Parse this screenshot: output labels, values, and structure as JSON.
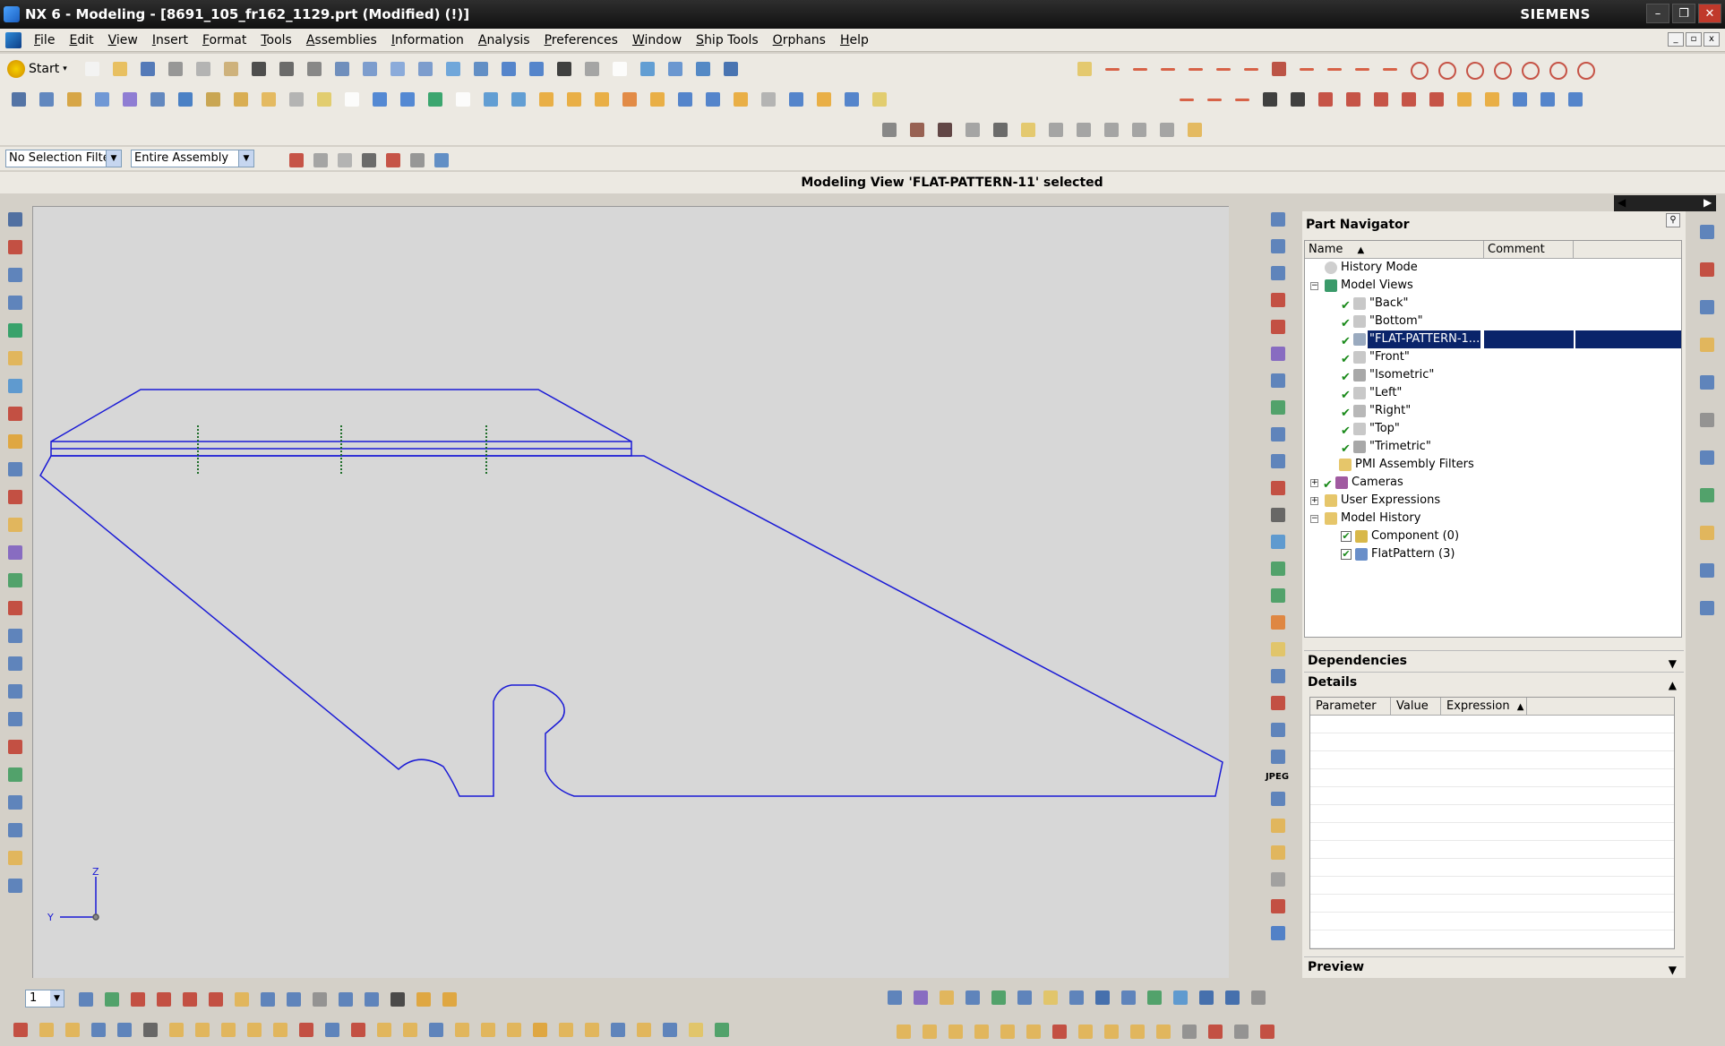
{
  "window": {
    "title": "NX 6 - Modeling - [8691_105_fr162_1129.prt (Modified)   (!)]",
    "brand": "SIEMENS",
    "minimize": "–",
    "restore": "❐",
    "close": "✕"
  },
  "menu": [
    "File",
    "Edit",
    "View",
    "Insert",
    "Format",
    "Tools",
    "Assemblies",
    "Information",
    "Analysis",
    "Preferences",
    "Window",
    "Ship Tools",
    "Orphans",
    "Help"
  ],
  "toolbar": {
    "start_label": "Start"
  },
  "selection": {
    "filter": "No Selection Filter",
    "scope": "Entire Assembly"
  },
  "status": "Modeling View 'FLAT-PATTERN-11' selected",
  "axes": {
    "z": "Z",
    "y": "Y"
  },
  "resource_bar": {
    "jpeg_label": "JPEG"
  },
  "part_navigator": {
    "title": "Part Navigator",
    "columns": {
      "name": "Name",
      "comment": "Comment"
    },
    "nodes": {
      "history_mode": "History Mode",
      "model_views": "Model Views",
      "back": "\"Back\"",
      "bottom": "\"Bottom\"",
      "flat_pattern": "\"FLAT-PATTERN-1...",
      "front": "\"Front\"",
      "isometric": "\"Isometric\"",
      "left": "\"Left\"",
      "right": "\"Right\"",
      "top": "\"Top\"",
      "trimetric": "\"Trimetric\"",
      "pmi": "PMI Assembly Filters",
      "cameras": "Cameras",
      "user_expressions": "User Expressions",
      "model_history": "Model History",
      "component": "Component (0)",
      "flatpattern": "FlatPattern (3)"
    }
  },
  "panels": {
    "dependencies": "Dependencies",
    "details": "Details",
    "preview": "Preview",
    "details_columns": {
      "parameter": "Parameter",
      "value": "Value",
      "expression": "Expression"
    }
  },
  "bottom": {
    "layer": "1"
  },
  "colors": {
    "geometry": "#1a1ad6",
    "selection": "#0a246a",
    "background": "#d7d7d7"
  }
}
